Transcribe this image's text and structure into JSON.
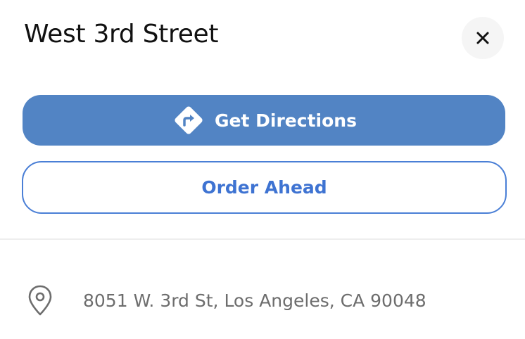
{
  "location": {
    "title": "West 3rd Street",
    "address": "8051 W. 3rd St, Los Angeles, CA 90048"
  },
  "actions": {
    "directions_label": "Get Directions",
    "order_label": "Order Ahead"
  },
  "icons": {
    "close": "close-icon",
    "directions": "directions-icon",
    "location": "map-pin-icon"
  },
  "colors": {
    "primary": "#5284c4",
    "outline": "#4a7fd6",
    "outline_text": "#3e73d2",
    "address_text": "#6d6d6d"
  }
}
